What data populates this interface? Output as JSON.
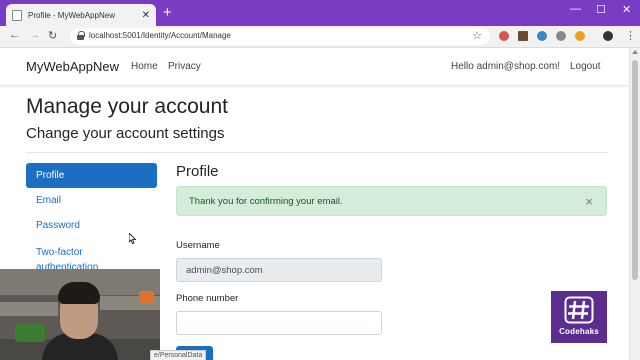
{
  "browser": {
    "tab_title": "Profile - MyWebAppNew",
    "tab_close": "✕",
    "new_tab": "+",
    "url": "localhost:5001/Identity/Account/Manage",
    "win_minimize": "—",
    "win_maximize": "☐",
    "win_close": "✕",
    "back": "←",
    "forward": "→",
    "reload": "↻",
    "bookmark_star": "☆",
    "menu": "⋮",
    "status_url": "e/PersonalData",
    "colors": {
      "frame": "#7a3cc2",
      "toolbar": "#f2f2f2"
    }
  },
  "navbar": {
    "brand": "MyWebAppNew",
    "home": "Home",
    "privacy": "Privacy",
    "greeting": "Hello admin@shop.com!",
    "logout": "Logout"
  },
  "page": {
    "title": "Manage your account",
    "subtitle": "Change your account settings"
  },
  "sidebar": {
    "items": [
      {
        "label": "Profile",
        "active": true
      },
      {
        "label": "Email",
        "active": false
      },
      {
        "label": "Password",
        "active": false
      },
      {
        "label": "Two-factor authentication",
        "active": false
      }
    ]
  },
  "profile": {
    "heading": "Profile",
    "alert_text": "Thank you for confirming your email.",
    "alert_close": "×",
    "username_label": "Username",
    "username_value": "admin@shop.com",
    "phone_label": "Phone number",
    "phone_value": ""
  },
  "overlay": {
    "logo_text": "Codehaks"
  },
  "colors": {
    "primary": "#1b6ec2",
    "alert_bg": "#d4edda",
    "alert_text": "#155724",
    "logo_bg": "#5b2d8f"
  }
}
